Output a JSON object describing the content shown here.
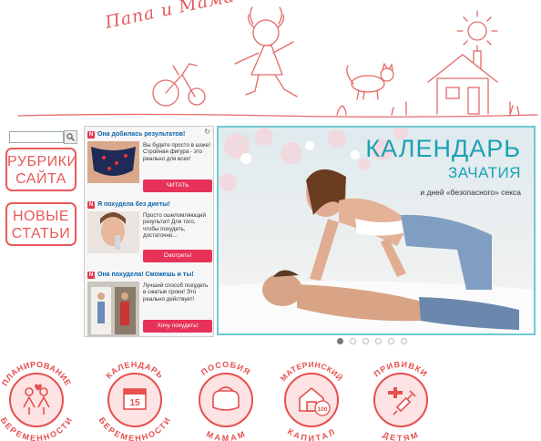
{
  "header": {
    "site_title": "Папа и Мама"
  },
  "menu": {
    "rubrics_line1": "РУБРИКИ",
    "rubrics_line2": "САЙТА",
    "new_line1": "НОВЫЕ",
    "new_line2": "СТАТЬИ"
  },
  "ads": [
    {
      "title": "Она добилась результатов!",
      "text": "Вы будете просто в шоке! Стройная фигура - это реально для всех!",
      "button": "ЧИТАТЬ"
    },
    {
      "title": "Я похудела без диеты!",
      "text": "Просто ошеломляющий результат! Для того, чтобы похудеть, достаточно...",
      "button": "Смотреть!"
    },
    {
      "title": "Она похудела! Сможешь и ты!",
      "text": "Лучший способ похудеть в сжатые сроки! Это реально действует!",
      "button": "Хочу похудеть!"
    }
  ],
  "banner": {
    "title": "КАЛЕНДАРЬ",
    "subtitle": "ЗАЧАТИЯ",
    "caption": "и дней «безопасного» секса"
  },
  "circles": [
    {
      "top": "ПЛАНИРОВАНИЕ",
      "bottom": "БЕРЕМЕННОСТИ"
    },
    {
      "top": "КАЛЕНДАРЬ",
      "bottom": "БЕРЕМЕННОСТИ",
      "badge": "15"
    },
    {
      "top": "ПОСОБИЯ",
      "bottom": "МАМАМ"
    },
    {
      "top": "МАТЕРИНСКИЙ",
      "bottom": "КАПИТАЛ",
      "badge": "100"
    },
    {
      "top": "ПРИВИВКИ",
      "bottom": "ДЕТЯМ"
    }
  ]
}
